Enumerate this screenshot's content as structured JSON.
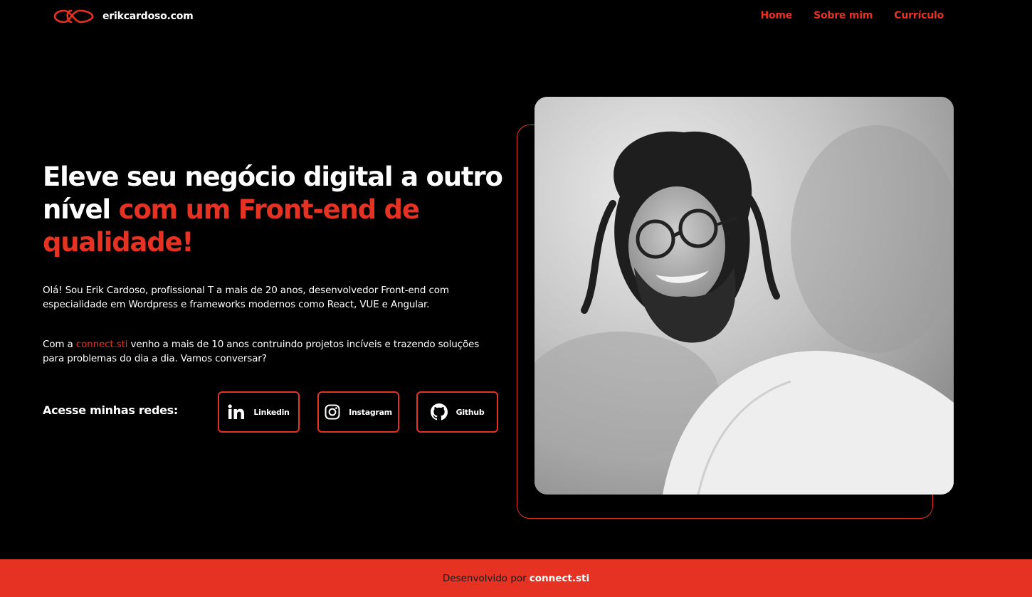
{
  "brand": {
    "site_name": "erikcardoso.com"
  },
  "nav": {
    "home": "Home",
    "about": "Sobre mim",
    "resume": "Currículo"
  },
  "hero": {
    "headline_line1": "Eleve seu negócio digital a outro",
    "headline_white_part": "nível ",
    "headline_accent": "com um Front-end de qualidade!",
    "paragraph1": "Olá! Sou Erik Cardoso, profissional T a mais de 20 anos, desenvolvedor Front-end com especialidade em Wordpress e frameworks modernos como React, VUE e Angular.",
    "paragraph2_before": "Com a ",
    "paragraph2_link": "connect.sti",
    "paragraph2_after": " venho a mais de 10 anos contruindo projetos incíveis e trazendo soluções para problemas do dia a dia. Vamos conversar?"
  },
  "social": {
    "label": "Acesse minhas redes:",
    "linkedin": "Linkedin",
    "instagram": "Instagram",
    "github": "Github"
  },
  "footer": {
    "prefix": "Desenvolvido por",
    "brand": "connect.sti"
  },
  "colors": {
    "accent": "#e63222",
    "background": "#000000",
    "text": "#ffffff"
  },
  "icons": [
    "infinity-logo-icon",
    "linkedin-icon",
    "instagram-icon",
    "github-icon"
  ]
}
